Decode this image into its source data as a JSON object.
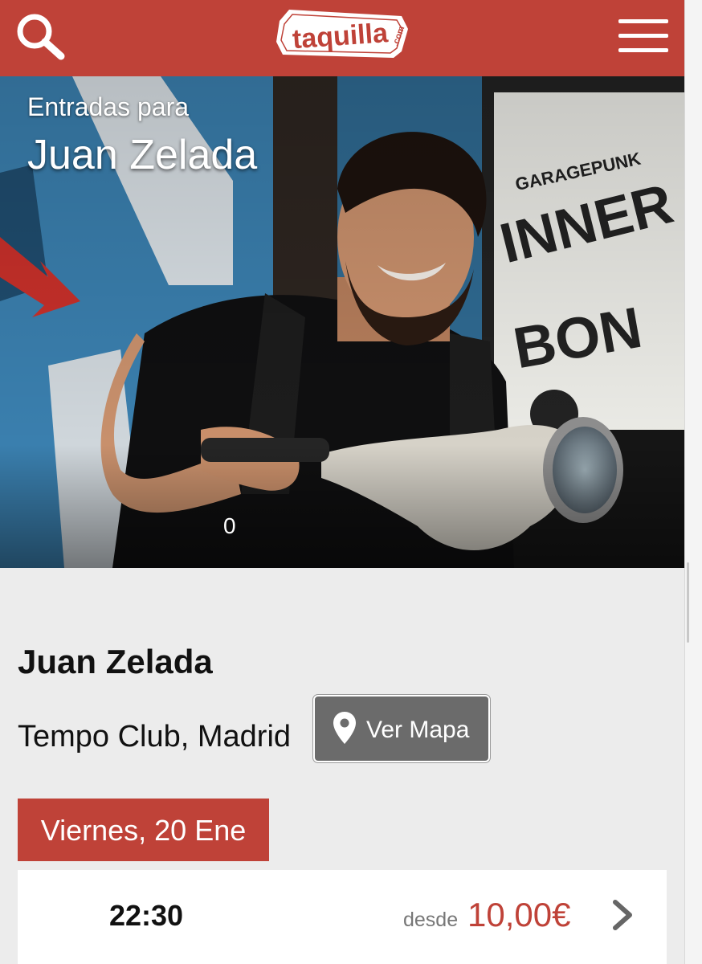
{
  "header": {
    "logo_text": "taquilla",
    "logo_suffix": ".com",
    "search_icon": "search-icon",
    "menu_icon": "hamburger-menu-icon"
  },
  "hero": {
    "subtitle": "Entradas para",
    "title": "Juan Zelada",
    "image_counter": "0"
  },
  "event": {
    "title": "Juan Zelada",
    "venue": "Tempo Club, Madrid",
    "map_button_label": "Ver Mapa",
    "map_icon": "map-pin-icon"
  },
  "dates": [
    {
      "label": "Viernes, 20 Ene",
      "sessions": [
        {
          "time": "22:30",
          "from_label": "desde",
          "price": "10,00€"
        }
      ]
    }
  ],
  "colors": {
    "brand_red": "#bf4238",
    "background": "#ececec",
    "button_gray": "#6b6b6b"
  }
}
